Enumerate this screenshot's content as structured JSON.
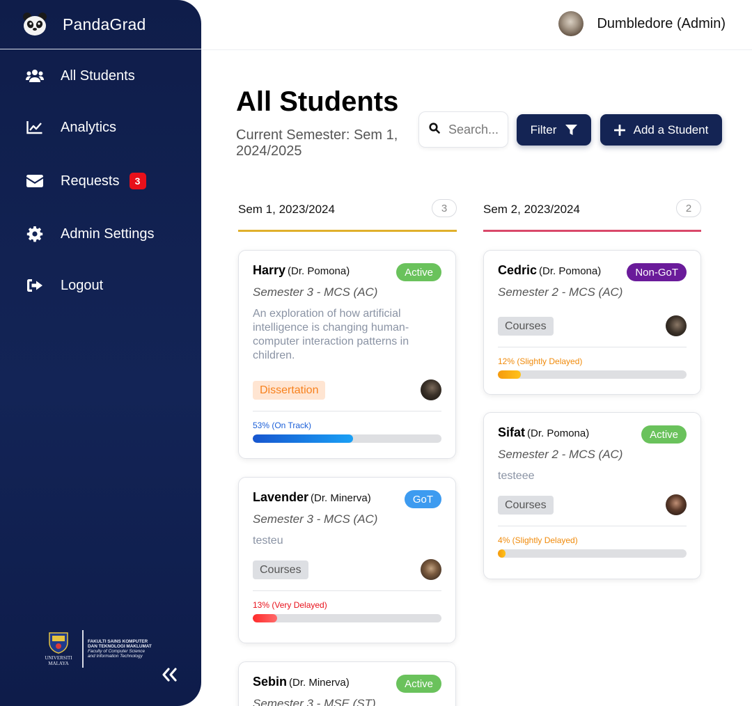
{
  "app": {
    "name": "PandaGrad"
  },
  "sidebar": {
    "items": [
      {
        "label": "All Students",
        "icon": "users-icon"
      },
      {
        "label": "Analytics",
        "icon": "chart-line-icon"
      },
      {
        "label": "Requests",
        "icon": "envelope-icon",
        "badge": "3"
      },
      {
        "label": "Admin Settings",
        "icon": "gear-icon"
      },
      {
        "label": "Logout",
        "icon": "logout-icon"
      }
    ],
    "logo": {
      "university": "UNIVERSITI MALAYA",
      "faculty_ms_1": "FAKULTI SAINS KOMPUTER",
      "faculty_ms_2": "DAN TEKNOLOGI MAKLUMAT",
      "faculty_en_1": "Faculty of Computer Science",
      "faculty_en_2": "and Information Technology"
    }
  },
  "header": {
    "user": "Dumbledore (Admin)"
  },
  "page": {
    "title": "All Students",
    "semester": "Current Semester: Sem 1, 2024/2025",
    "search_placeholder": "Search...",
    "filter_label": "Filter",
    "add_label": "Add a Student"
  },
  "columns": [
    {
      "title": "Sem 1, 2023/2024",
      "count": "3",
      "color": "#e0b02c",
      "students": [
        {
          "name": "Harry",
          "supervisor": "(Dr. Pomona)",
          "status": "Active",
          "program": "Semester 3 - MCS (AC)",
          "description": "An exploration of how artificial intelligence is changing human-computer interaction patterns in children.",
          "tag": "Dissertation",
          "progress": 53,
          "progress_label": "53% (On Track)"
        },
        {
          "name": "Lavender",
          "supervisor": "(Dr. Minerva)",
          "status": "GoT",
          "program": "Semester 3 - MCS (AC)",
          "description": "testeu",
          "tag": "Courses",
          "progress": 13,
          "progress_label": "13% (Very Delayed)"
        },
        {
          "name": "Sebin",
          "supervisor": "(Dr. Minerva)",
          "status": "Active",
          "program": "Semester 3 - MSE (ST)"
        }
      ]
    },
    {
      "title": "Sem 2, 2023/2024",
      "count": "2",
      "color": "#d9486a",
      "students": [
        {
          "name": "Cedric",
          "supervisor": "(Dr. Pomona)",
          "status": "Non-GoT",
          "program": "Semester 2 - MCS (AC)",
          "tag": "Courses",
          "progress": 12,
          "progress_label": "12% (Slightly Delayed)"
        },
        {
          "name": "Sifat",
          "supervisor": "(Dr. Pomona)",
          "status": "Active",
          "program": "Semester 2 - MCS (AC)",
          "description": "testeee",
          "tag": "Courses",
          "progress": 4,
          "progress_label": "4% (Slightly Delayed)"
        }
      ]
    }
  ],
  "colors": {
    "sidebar_bg": "#132456",
    "accent": "#142454",
    "on_track": "#1a73e8",
    "slightly_delayed": "#f59a0c",
    "very_delayed": "#e8101a",
    "active": "#6ac25c",
    "got": "#3d9bf0",
    "non_got": "#6a1b9a"
  }
}
